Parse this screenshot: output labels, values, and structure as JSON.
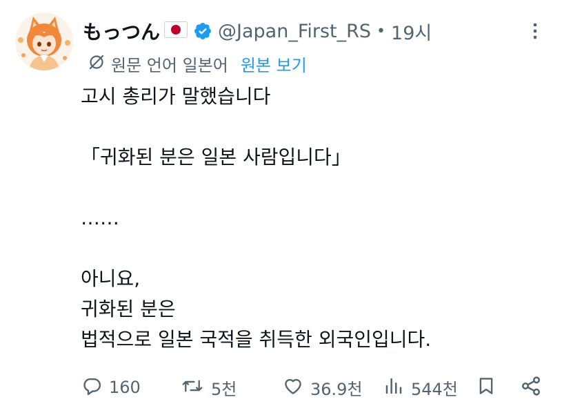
{
  "author": {
    "name": "もっつん",
    "handle": "@Japan_First_RS",
    "separator": "•",
    "time": "19시"
  },
  "translation": {
    "label": "원문 언어 일본어",
    "link": "원본 보기"
  },
  "tweet": {
    "lines": [
      "고시 총리가 말했습니다",
      "",
      "「귀화된 분은 일본 사람입니다」",
      "",
      "……",
      "",
      "아니요,",
      "귀화된 분은",
      "법적으로 일본 국적을 취득한 외국인입니다."
    ]
  },
  "actions": {
    "replies": "160",
    "reposts": "5천",
    "likes": "36.9천",
    "views": "544천"
  },
  "colors": {
    "text": "#0f1419",
    "secondary": "#536471",
    "accent": "#1d9bf0",
    "flag_red": "#bc002d"
  },
  "icons": [
    "avatar",
    "japan-flag-icon",
    "verified-badge-icon",
    "more-icon",
    "translate-icon",
    "reply-icon",
    "repost-icon",
    "like-icon",
    "views-icon",
    "bookmark-icon",
    "share-icon"
  ]
}
